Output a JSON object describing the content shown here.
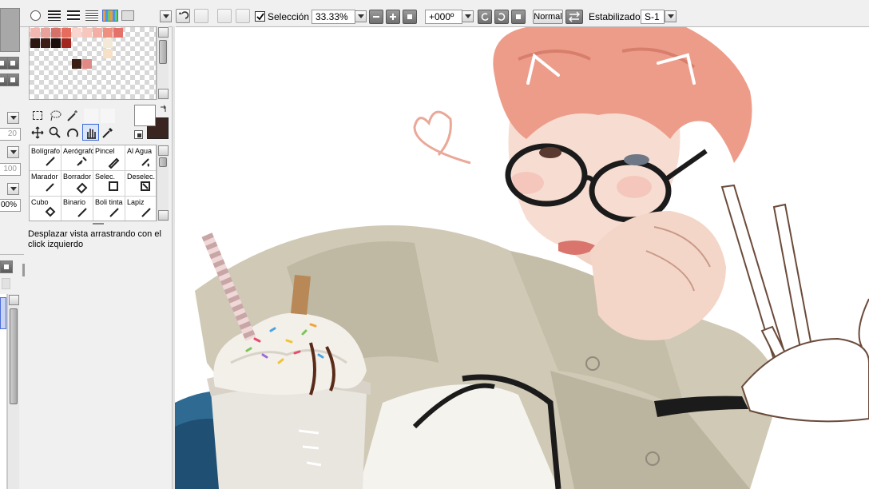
{
  "toolbar": {
    "selection_label": "Selección",
    "selection_checked": true,
    "zoom_value": "33.33%",
    "rotation_value": "+000º",
    "blend_mode": "Normal",
    "stabilizer_label": "Estabilizador",
    "stabilizer_value": "S-1"
  },
  "left_panel": {
    "size_value": "20",
    "density_value": "100",
    "opacity_value": "00%"
  },
  "palette": {
    "rows": [
      [
        "#f2b7b0",
        "#e9a29b",
        "#d4726a",
        "#e66d5d",
        "#f9d5cf",
        "#f7c6bd",
        "#f4aea3",
        "#ef8f80",
        "#e5726a"
      ],
      [
        "#2b1612",
        "#3c1c17",
        "#1a0d0b",
        "#a3251f",
        "",
        "",
        "",
        "#f3e9d8",
        ""
      ],
      [
        "",
        "",
        "",
        "",
        "",
        "",
        "",
        "#f6e1c6",
        ""
      ],
      [
        "",
        "",
        "",
        "",
        "#3a1e14",
        "#df8a85",
        "",
        "",
        ""
      ]
    ]
  },
  "brushes": [
    {
      "label": "Bolígrafo",
      "icon": "pen-icon"
    },
    {
      "label": "Aerógrafo",
      "icon": "airbrush-icon"
    },
    {
      "label": "Pincel",
      "icon": "brush-icon"
    },
    {
      "label": "Al Agua",
      "icon": "watercolor-icon"
    },
    {
      "label": "Marador",
      "icon": "marker-icon"
    },
    {
      "label": "Borrador",
      "icon": "eraser-icon"
    },
    {
      "label": "Selec.",
      "icon": "select-brush-icon"
    },
    {
      "label": "Deselec.",
      "icon": "deselect-brush-icon"
    },
    {
      "label": "Cubo",
      "icon": "bucket-icon"
    },
    {
      "label": "Binario",
      "icon": "binary-pen-icon"
    },
    {
      "label": "Boli tinta",
      "icon": "ink-pen-icon"
    },
    {
      "label": "Lapiz",
      "icon": "pencil-icon"
    }
  ],
  "hint_text": "Desplazar vista arrastrando con el click izquierdo",
  "colors": {
    "foreground": "#ffffff",
    "background": "#3a2520",
    "hair": "#ee9c8a",
    "shirt": "#cfc9b6"
  }
}
